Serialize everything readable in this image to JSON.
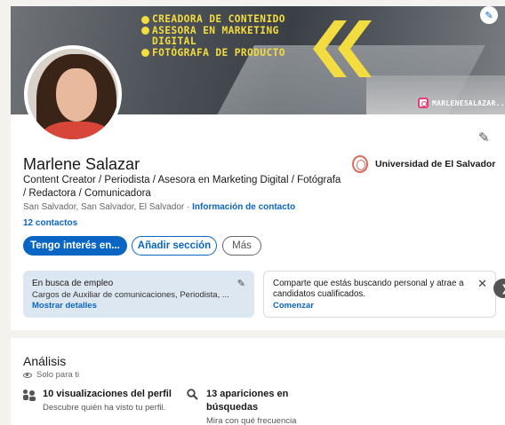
{
  "banner": {
    "lines": [
      "CREADORA DE CONTENIDO",
      "ASESORA EN MARKETING",
      "DIGITAL",
      "FOTÓGRAFA DE PRODUCTO"
    ],
    "handle": "MARLENESALAZAR...",
    "accent": "#f3dc3f"
  },
  "profile": {
    "name": "Marlene Salazar",
    "headline": "Content Creator / Periodista / Asesora en Marketing Digital / Fotógrafa / Redactora / Comunicadora",
    "location": "San Salvador, San Salvador, El Salvador ·",
    "contact_link": "Información de contacto",
    "contacts": "12 contactos",
    "education": "Universidad de El Salvador"
  },
  "actions": {
    "primary": "Tengo interés en...",
    "add_section": "Añadir sección",
    "more": "Más"
  },
  "open_to_work": {
    "title": "En busca de empleo",
    "subtitle": "Cargos de Auxiliar de comunicaciones, Periodista, ...",
    "link": "Mostrar detalles"
  },
  "share_card": {
    "text": "Comparte que estás buscando personal y atrae a candidatos cualificados.",
    "link": "Comenzar"
  },
  "analytics": {
    "title": "Análisis",
    "privacy": "Solo para ti",
    "stats": [
      {
        "heading": "10 visualizaciones del perfil",
        "desc": "Descubre quién ha visto tu perfil."
      },
      {
        "heading": "13 apariciones en búsquedas",
        "desc": "Mira con qué frecuencia"
      }
    ]
  },
  "colors": {
    "brand": "#0a66c2",
    "panel": "#dde7f1"
  }
}
